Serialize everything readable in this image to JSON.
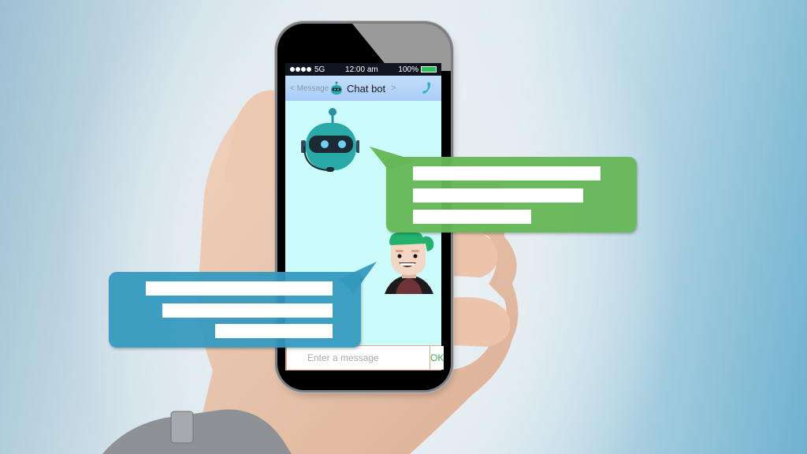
{
  "statusbar": {
    "signal_dots": 4,
    "network": "5G",
    "time": "12:00 am",
    "battery": "100%",
    "battery_level": 1.0,
    "battery_color": "#2fbf5a"
  },
  "navbar": {
    "back_label": "< Message",
    "title": "Chat bot",
    "title_chevron": ">",
    "call_icon": "phone-icon"
  },
  "chat": {
    "bot_avatar": "robot-avatar",
    "user_avatar": "user-avatar",
    "bot_bubble": {
      "color": "#66b757",
      "text_lines": 3
    },
    "user_bubble": {
      "color": "#3499be",
      "text_lines": 3
    }
  },
  "composer": {
    "placeholder": "Enter a message",
    "send_label": "OK",
    "send_color": "#3fae47"
  },
  "colors": {
    "screen_bg": "#ccfbfb",
    "navbar_bg": "#b4d4f8",
    "statusbar_bg": "#0e1520"
  }
}
